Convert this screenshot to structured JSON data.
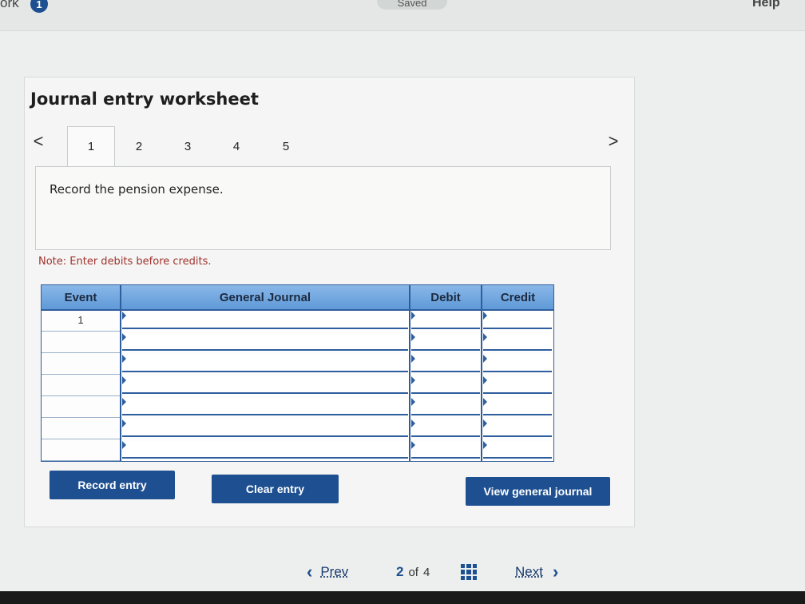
{
  "topbar": {
    "work_label": "ork",
    "badge_count": "1",
    "saved_label": "Saved",
    "help_label": "Help"
  },
  "worksheet": {
    "title": "Journal entry worksheet",
    "prev_arrow": "<",
    "next_arrow": ">",
    "tabs": [
      "1",
      "2",
      "3",
      "4",
      "5"
    ],
    "active_tab": "1",
    "instruction": "Record the pension expense.",
    "note": "Note: Enter debits before credits."
  },
  "journal": {
    "headers": {
      "event": "Event",
      "general_journal": "General Journal",
      "debit": "Debit",
      "credit": "Credit"
    },
    "rows": [
      {
        "event": "1",
        "account": "",
        "debit": "",
        "credit": ""
      },
      {
        "event": "",
        "account": "",
        "debit": "",
        "credit": ""
      },
      {
        "event": "",
        "account": "",
        "debit": "",
        "credit": ""
      },
      {
        "event": "",
        "account": "",
        "debit": "",
        "credit": ""
      },
      {
        "event": "",
        "account": "",
        "debit": "",
        "credit": ""
      },
      {
        "event": "",
        "account": "",
        "debit": "",
        "credit": ""
      },
      {
        "event": "",
        "account": "",
        "debit": "",
        "credit": ""
      }
    ]
  },
  "buttons": {
    "record": "Record entry",
    "clear": "Clear entry",
    "view": "View general journal"
  },
  "pager": {
    "prev_icon": "‹",
    "prev": "Prev",
    "current": "2",
    "of": "of",
    "total": "4",
    "next": "Next",
    "next_icon": "›"
  },
  "colors": {
    "accent": "#1d4f91",
    "header_blue": "#5f9ad8",
    "note_red": "#a0322e"
  }
}
